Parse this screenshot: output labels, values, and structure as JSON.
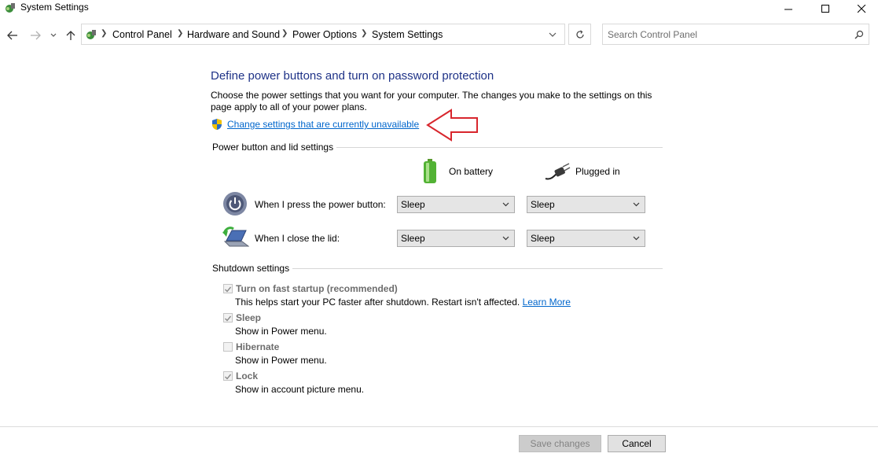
{
  "window": {
    "title": "System Settings",
    "icon": "power-options-icon"
  },
  "nav": {
    "breadcrumb": [
      "Control Panel",
      "Hardware and Sound",
      "Power Options",
      "System Settings"
    ],
    "search_placeholder": "Search Control Panel"
  },
  "main": {
    "heading": "Define power buttons and turn on password protection",
    "description": "Choose the power settings that you want for your computer. The changes you make to the settings on this page apply to all of your power plans.",
    "change_link": "Change settings that are currently unavailable",
    "power_section": {
      "title": "Power button and lid settings",
      "col_battery": "On battery",
      "col_plugged": "Plugged in",
      "rows": [
        {
          "label": "When I press the power button:",
          "battery": "Sleep",
          "plugged": "Sleep"
        },
        {
          "label": "When I close the lid:",
          "battery": "Sleep",
          "plugged": "Sleep"
        }
      ]
    },
    "shutdown_section": {
      "title": "Shutdown settings",
      "items": [
        {
          "label": "Turn on fast startup (recommended)",
          "desc": "This helps start your PC faster after shutdown. Restart isn't affected.",
          "link": "Learn More",
          "checked": true
        },
        {
          "label": "Sleep",
          "desc": "Show in Power menu.",
          "checked": true
        },
        {
          "label": "Hibernate",
          "desc": "Show in Power menu.",
          "checked": false
        },
        {
          "label": "Lock",
          "desc": "Show in account picture menu.",
          "checked": true
        }
      ]
    }
  },
  "footer": {
    "save_label": "Save changes",
    "cancel_label": "Cancel"
  },
  "colors": {
    "heading": "#1e3287",
    "link": "#0066cc",
    "annotation_arrow": "#d8262d"
  }
}
